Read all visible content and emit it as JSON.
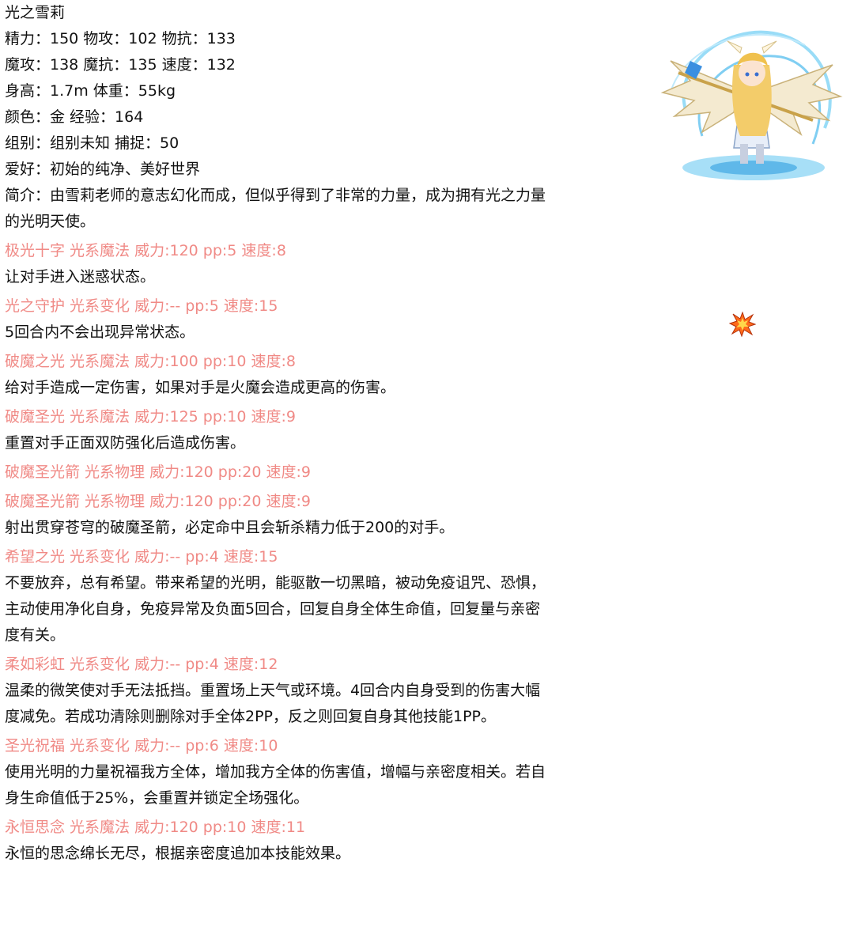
{
  "name": "光之雪莉",
  "stats": {
    "line1": "精力：150 物攻：102 物抗：133",
    "line2": "魔攻：138 魔抗：135 速度：132",
    "line3": "身高：1.7m 体重：55kg",
    "line4": "颜色：金 经验：164",
    "line5": "组别：组别未知 捕捉：50",
    "hobby": "爱好：初始的纯净、美好世界",
    "bio": "简介：由雪莉老师的意志幻化而成，但似乎得到了非常的力量，成为拥有光之力量的光明天使。"
  },
  "skills": [
    {
      "head": "极光十字 光系魔法 威力:120 pp:5 速度:8",
      "desc": "让对手进入迷惑状态。"
    },
    {
      "head": "光之守护 光系变化 威力:-- pp:5 速度:15",
      "desc": "5回合内不会出现异常状态。"
    },
    {
      "head": "破魔之光 光系魔法 威力:100 pp:10 速度:8",
      "desc": "给对手造成一定伤害，如果对手是火魔会造成更高的伤害。"
    },
    {
      "head": "破魔圣光 光系魔法 威力:125 pp:10 速度:9",
      "desc": "重置对手正面双防强化后造成伤害。"
    },
    {
      "head": "破魔圣光箭 光系物理 威力:120 pp:20 速度:9",
      "desc": ""
    },
    {
      "head": "破魔圣光箭 光系物理 威力:120 pp:20 速度:9",
      "desc": "射出贯穿苍穹的破魔圣箭，必定命中且会斩杀精力低于200的对手。"
    },
    {
      "head": "希望之光 光系变化 威力:-- pp:4 速度:15",
      "desc": "不要放弃，总有希望。带来希望的光明，能驱散一切黑暗，被动免疫诅咒、恐惧，主动使用净化自身，免疫异常及负面5回合，回复自身全体生命值，回复量与亲密度有关。"
    },
    {
      "head": "柔如彩虹 光系变化 威力:-- pp:4 速度:12",
      "desc": "温柔的微笑使对手无法抵挡。重置场上天气或环境。4回合内自身受到的伤害大幅度减免。若成功清除则删除对手全体2PP，反之则回复自身其他技能1PP。"
    },
    {
      "head": "圣光祝福 光系变化 威力:-- pp:6 速度:10",
      "desc": "使用光明的力量祝福我方全体，增加我方全体的伤害值，增幅与亲密度相关。若自身生命值低于25%，会重置并锁定全场强化。"
    },
    {
      "head": "永恒思念 光系魔法 威力:120 pp:10 速度:11",
      "desc": "永恒的思念绵长无尽，根据亲密度追加本技能效果。"
    }
  ],
  "colors": {
    "skill_head": "#f08a86",
    "text": "#111111"
  },
  "images": {
    "portrait": "angel-character-portrait",
    "burst": "explosion-icon"
  }
}
